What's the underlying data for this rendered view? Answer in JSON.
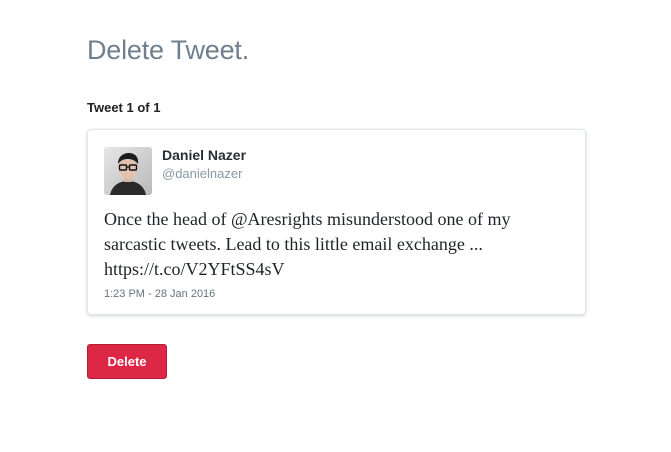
{
  "page": {
    "title": "Delete Tweet.",
    "counter": "Tweet 1 of 1"
  },
  "tweet": {
    "author_name": "Daniel Nazer",
    "author_handle": "@danielnazer",
    "text": "Once the head of @Aresrights misunderstood one of my sarcastic tweets. Lead to this little email exchange ... https://t.co/V2YFtSS4sV",
    "timestamp": "1:23 PM - 28 Jan 2016",
    "avatar_icon": "person-photo-avatar"
  },
  "actions": {
    "delete_label": "Delete",
    "delete_color": "#dc2846"
  },
  "colors": {
    "title": "#6f7f8f",
    "handle": "#8899a6"
  }
}
